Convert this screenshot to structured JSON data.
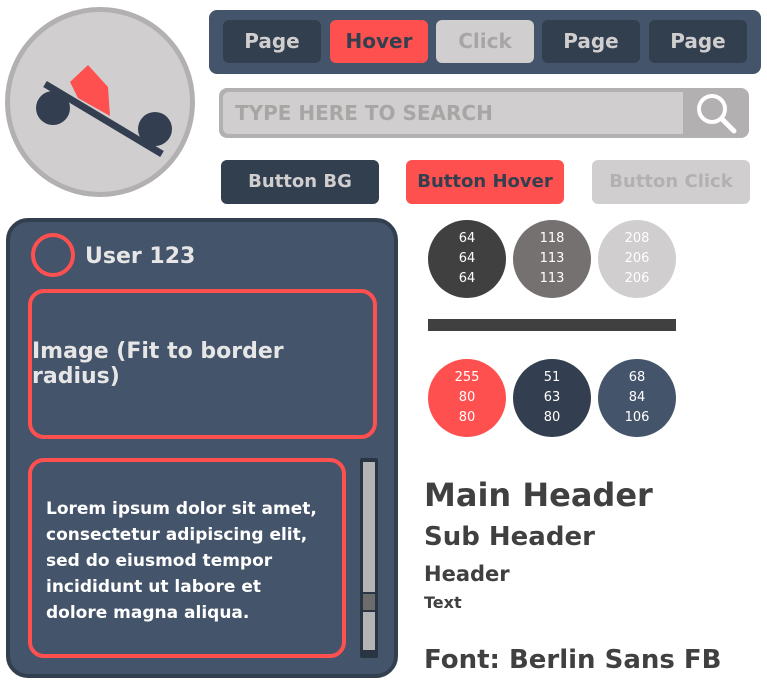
{
  "nav": {
    "buttons": [
      {
        "label": "Page",
        "bg": "#323f4f",
        "fg": "#d0cece"
      },
      {
        "label": "Hover",
        "bg": "#ff5050",
        "fg": "#323f4f"
      },
      {
        "label": "Click",
        "bg": "#d0cece",
        "fg": "#a8a5a5"
      },
      {
        "label": "Page",
        "bg": "#323f4f",
        "fg": "#d0cece"
      },
      {
        "label": "Page",
        "bg": "#323f4f",
        "fg": "#d0cece"
      }
    ]
  },
  "search": {
    "placeholder": "TYPE HERE TO SEARCH",
    "icon": "magnifier-icon"
  },
  "buttons": [
    {
      "label": "Button BG",
      "bg": "#323f4f",
      "fg": "#d0cece"
    },
    {
      "label": "Button Hover",
      "bg": "#ff5050",
      "fg": "#323f4f"
    },
    {
      "label": "Button Click",
      "bg": "#d0cece",
      "fg": "#b2b0b0"
    }
  ],
  "card": {
    "user": "User 123",
    "image_label": "Image (Fit to border radius)",
    "body_text": "Lorem ipsum dolor sit amet, consectetur adipiscing elit, sed do eiusmod tempor incididunt ut labore et dolore magna aliqua."
  },
  "swatches": [
    {
      "r": "64",
      "g": "64",
      "b": "64",
      "hex": "#404040"
    },
    {
      "r": "118",
      "g": "113",
      "b": "113",
      "hex": "#767171"
    },
    {
      "r": "208",
      "g": "206",
      "b": "206",
      "hex": "#d0cece"
    },
    {
      "r": "255",
      "g": "80",
      "b": "80",
      "hex": "#ff5050"
    },
    {
      "r": "51",
      "g": "63",
      "b": "80",
      "hex": "#333f50"
    },
    {
      "r": "68",
      "g": "84",
      "b": "106",
      "hex": "#44546a"
    }
  ],
  "typography": {
    "main_header": "Main Header",
    "sub_header": "Sub Header",
    "header": "Header",
    "text": "Text",
    "font_label": "Font: Berlin Sans FB"
  }
}
